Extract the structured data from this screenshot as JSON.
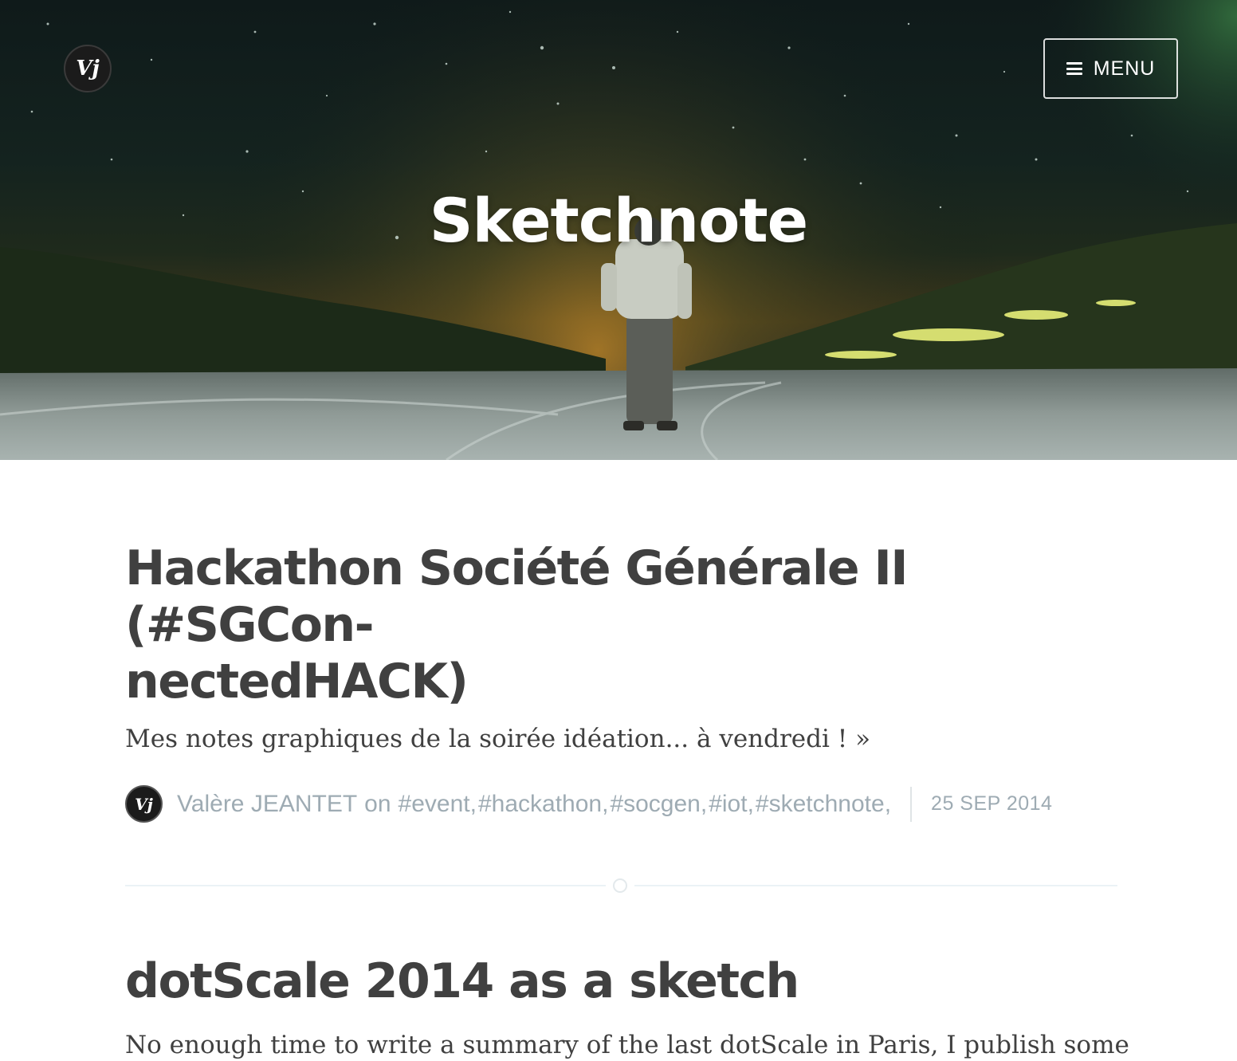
{
  "header": {
    "logo_text": "Vj",
    "menu_label": "MENU",
    "title": "Sketchnote"
  },
  "posts": [
    {
      "title": "Hackathon Société Générale II (#SGCon-nectedHACK)",
      "title_line1": "Hackathon Société Générale II (#SGCon-",
      "title_line2": "nectedHACK)",
      "excerpt": "Mes notes graphiques de la soirée idéation... à vendredi ! »",
      "author": "Valère JEANTET",
      "on": "on",
      "tags": [
        "#event,",
        "#hackathon,",
        "#socgen,",
        "#iot,",
        "#sketchnote,"
      ],
      "date": "25 SEP 2014"
    },
    {
      "title": "dotScale 2014 as a sketch",
      "excerpt": "No enough time to write a summary of the last dotScale in Paris, I publish some"
    }
  ],
  "colors": {
    "title": "#404040",
    "meta": "#9eabb3",
    "divider": "#ebf2f6"
  }
}
